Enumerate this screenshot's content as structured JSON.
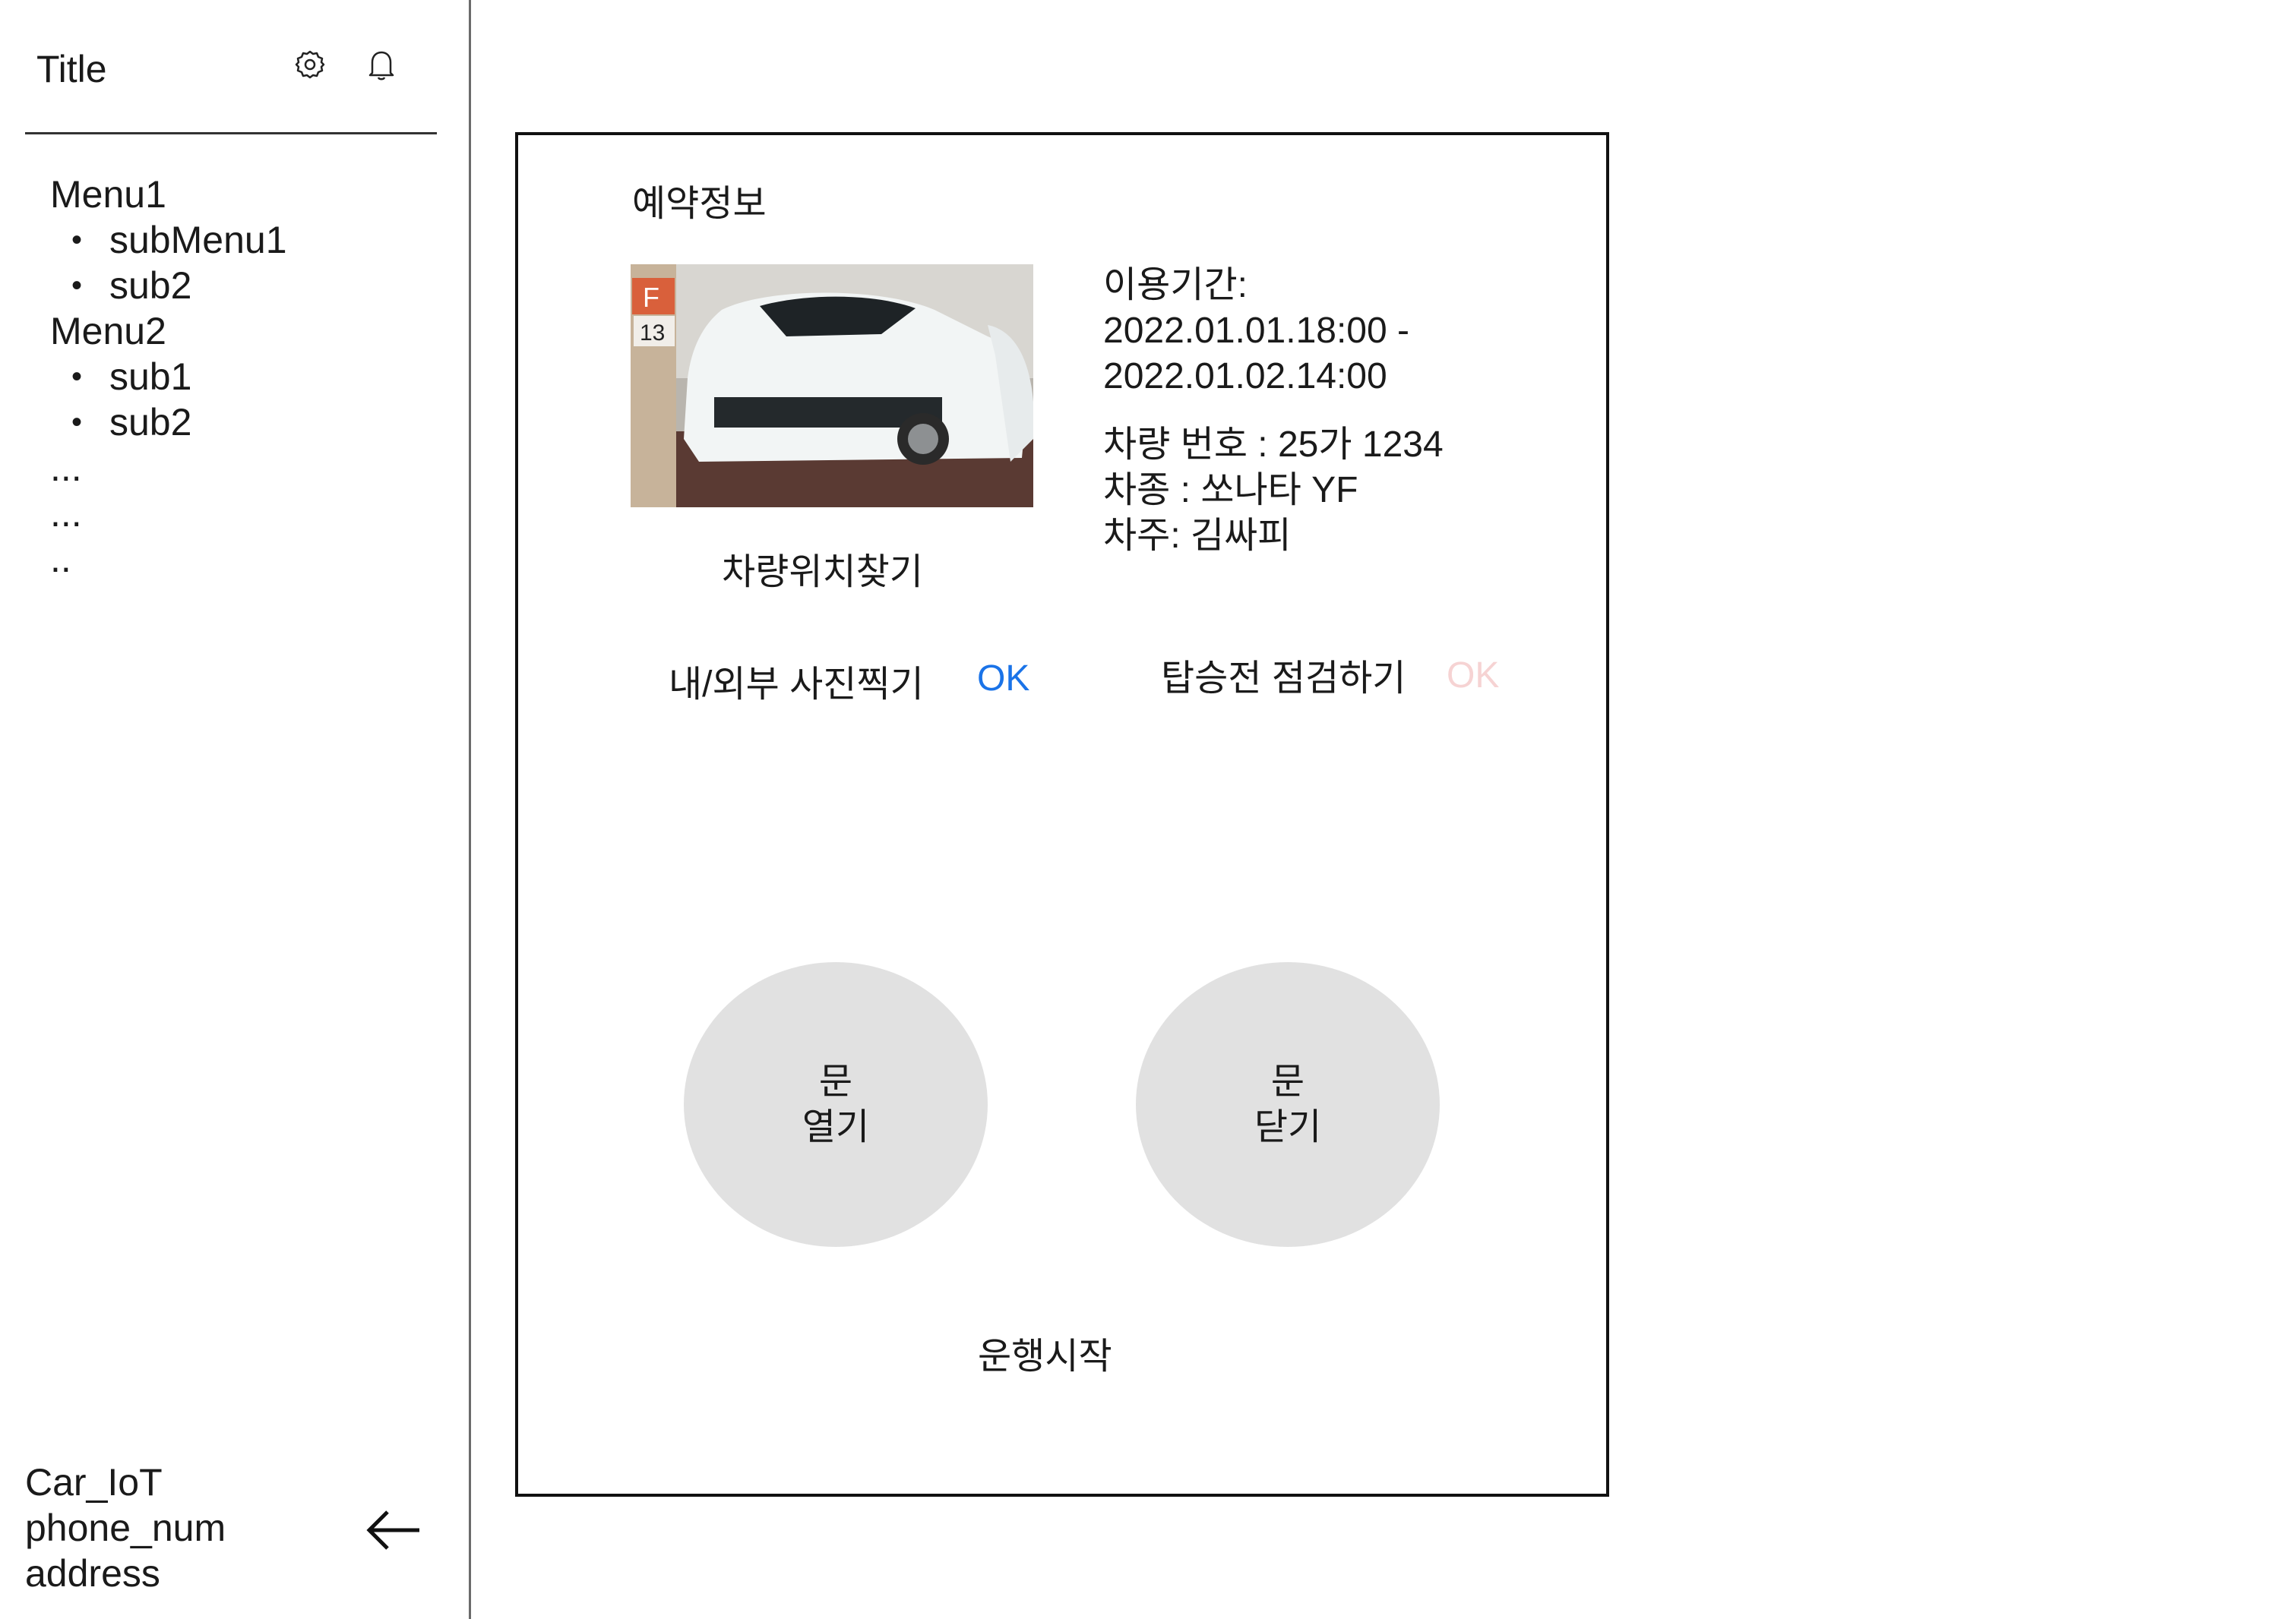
{
  "sidebar": {
    "title": "Title",
    "icons": [
      "gear-icon",
      "bell-icon"
    ],
    "menu": [
      {
        "label": "Menu1",
        "subs": [
          "subMenu1",
          "sub2"
        ]
      },
      {
        "label": "Menu2",
        "subs": [
          "sub1",
          "sub2"
        ]
      }
    ],
    "ellipsis": [
      "...",
      "...",
      ".."
    ],
    "footer": {
      "line1": "Car_IoT",
      "line2": "phone_num",
      "line3": "address"
    }
  },
  "panel": {
    "heading": "예약정보",
    "find_car_label": "차량위치찾기",
    "period_label": "이용기간:",
    "period_start": "2022.01.01.18:00 -",
    "period_end": "2022.01.02.14:00",
    "plate": "차량 번호 : 25가 1234",
    "model": "차종 : 쏘나타 YF",
    "owner": "차주: 김싸피",
    "photo_task": "내/외부 사진찍기",
    "photo_ok": "OK",
    "check_task": "탑승전 점검하기",
    "check_ok": "OK",
    "open_door": {
      "line1": "문",
      "line2": "열기"
    },
    "close_door": {
      "line1": "문",
      "line2": "닫기"
    },
    "start_drive": "운행시작"
  },
  "colors": {
    "ok_done": "#1a73e8",
    "ok_pending": "#f6d3d3",
    "circle": "#e1e1e1"
  }
}
